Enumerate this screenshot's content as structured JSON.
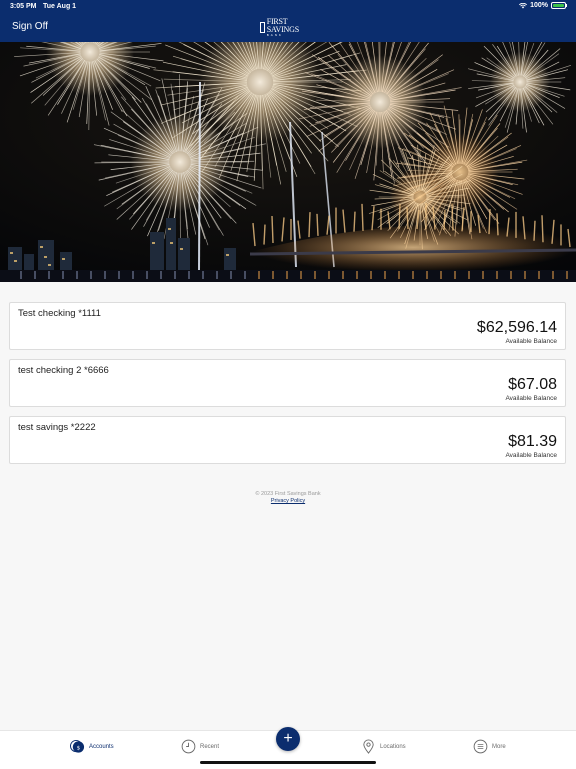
{
  "status_bar": {
    "time": "3:05 PM",
    "date": "Tue Aug 1",
    "battery": "100%"
  },
  "header": {
    "sign_off": "Sign Off",
    "brand": "FIRST SAVINGS",
    "brand_sub": "BANK"
  },
  "accounts": [
    {
      "name": "Test checking *1111",
      "amount": "$62,596.14",
      "label": "Available Balance"
    },
    {
      "name": "test checking 2 *6666",
      "amount": "$67.08",
      "label": "Available Balance"
    },
    {
      "name": "test savings *2222",
      "amount": "$81.39",
      "label": "Available Balance"
    }
  ],
  "footer": {
    "copyright": "© 2023 First Savings Bank",
    "privacy": "Privacy Policy"
  },
  "tabs": [
    {
      "label": "Accounts",
      "icon": "accounts-icon"
    },
    {
      "label": "Recent",
      "icon": "clock-icon"
    },
    {
      "label": "Locations",
      "icon": "location-pin-icon"
    },
    {
      "label": "More",
      "icon": "menu-icon"
    }
  ],
  "fab_icon": "+",
  "colors": {
    "brand_navy": "#0b2d6e",
    "page_bg": "#f7f7f7",
    "battery_green": "#3cc24a"
  }
}
